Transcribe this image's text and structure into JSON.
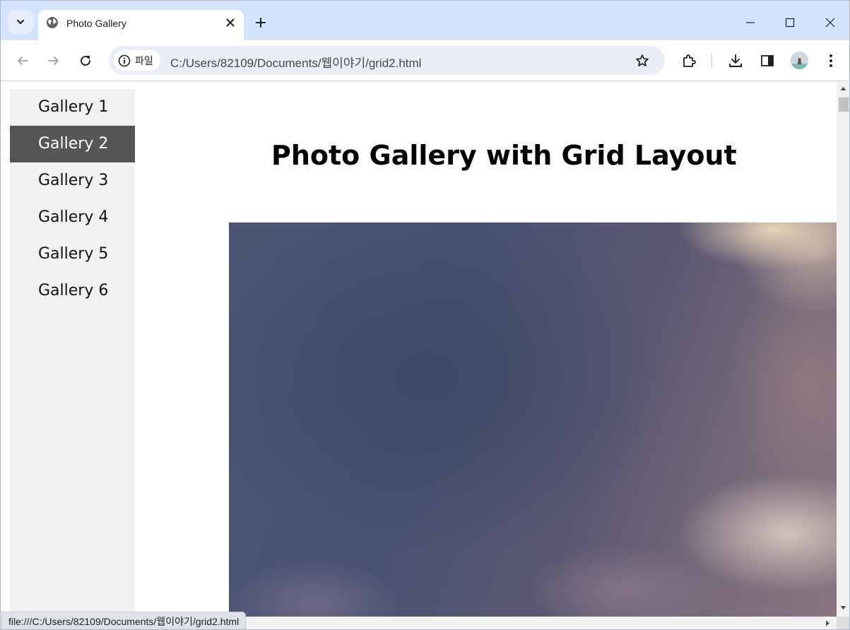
{
  "browser": {
    "tab": {
      "title": "Photo Gallery",
      "icon": "globe-icon"
    },
    "omnibox": {
      "chip_label": "파일",
      "url": "C:/Users/82109/Documents/웹이야기/grid2.html"
    },
    "status_url": "file:///C:/Users/82109/Documents/웹이야기/grid2.html"
  },
  "sidebar": {
    "items": [
      {
        "label": "Gallery 1",
        "active": false
      },
      {
        "label": "Gallery 2",
        "active": true
      },
      {
        "label": "Gallery 3",
        "active": false
      },
      {
        "label": "Gallery 4",
        "active": false
      },
      {
        "label": "Gallery 5",
        "active": false
      },
      {
        "label": "Gallery 6",
        "active": false
      }
    ]
  },
  "main": {
    "title": "Photo Gallery with Grid Layout"
  },
  "colors": {
    "tabstrip_bg": "#d3e3fd",
    "sidebar_bg": "#f1f1f1",
    "active_item_bg": "#555555",
    "active_item_text": "#ffffff"
  }
}
